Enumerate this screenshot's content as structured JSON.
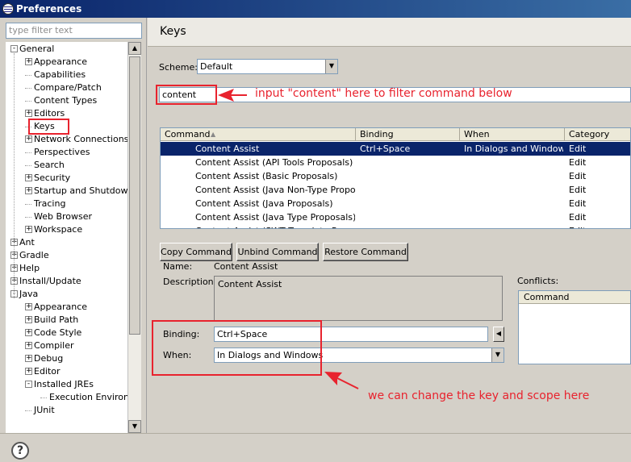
{
  "window": {
    "title": "Preferences"
  },
  "filter": {
    "placeholder": "type filter text"
  },
  "tree": [
    {
      "label": "General",
      "level": 0,
      "expander": "-"
    },
    {
      "label": "Appearance",
      "level": 1,
      "expander": "+"
    },
    {
      "label": "Capabilities",
      "level": 1,
      "expander": ""
    },
    {
      "label": "Compare/Patch",
      "level": 1,
      "expander": ""
    },
    {
      "label": "Content Types",
      "level": 1,
      "expander": ""
    },
    {
      "label": "Editors",
      "level": 1,
      "expander": "+"
    },
    {
      "label": "Keys",
      "level": 1,
      "expander": "",
      "selected": true
    },
    {
      "label": "Network Connections",
      "level": 1,
      "expander": "+"
    },
    {
      "label": "Perspectives",
      "level": 1,
      "expander": ""
    },
    {
      "label": "Search",
      "level": 1,
      "expander": ""
    },
    {
      "label": "Security",
      "level": 1,
      "expander": "+"
    },
    {
      "label": "Startup and Shutdown",
      "level": 1,
      "expander": "+"
    },
    {
      "label": "Tracing",
      "level": 1,
      "expander": ""
    },
    {
      "label": "Web Browser",
      "level": 1,
      "expander": ""
    },
    {
      "label": "Workspace",
      "level": 1,
      "expander": "+"
    },
    {
      "label": "Ant",
      "level": 0,
      "expander": "+"
    },
    {
      "label": "Gradle",
      "level": 0,
      "expander": "+"
    },
    {
      "label": "Help",
      "level": 0,
      "expander": "+"
    },
    {
      "label": "Install/Update",
      "level": 0,
      "expander": "+"
    },
    {
      "label": "Java",
      "level": 0,
      "expander": "-"
    },
    {
      "label": "Appearance",
      "level": 1,
      "expander": "+"
    },
    {
      "label": "Build Path",
      "level": 1,
      "expander": "+"
    },
    {
      "label": "Code Style",
      "level": 1,
      "expander": "+"
    },
    {
      "label": "Compiler",
      "level": 1,
      "expander": "+"
    },
    {
      "label": "Debug",
      "level": 1,
      "expander": "+"
    },
    {
      "label": "Editor",
      "level": 1,
      "expander": "+"
    },
    {
      "label": "Installed JREs",
      "level": 1,
      "expander": "-"
    },
    {
      "label": "Execution Environ",
      "level": 2,
      "expander": ""
    },
    {
      "label": "JUnit",
      "level": 1,
      "expander": ""
    }
  ],
  "page": {
    "title": "Keys"
  },
  "scheme": {
    "label": "Scheme:",
    "value": "Default"
  },
  "filter_input": {
    "value": "content"
  },
  "table": {
    "columns": [
      "Command",
      "Binding",
      "When",
      "Category"
    ],
    "rows": [
      {
        "command": "Content Assist",
        "binding": "Ctrl+Space",
        "when": "In Dialogs and Windows",
        "category": "Edit",
        "selected": true
      },
      {
        "command": "Content Assist (API Tools Proposals)",
        "binding": "",
        "when": "",
        "category": "Edit"
      },
      {
        "command": "Content Assist (Basic Proposals)",
        "binding": "",
        "when": "",
        "category": "Edit"
      },
      {
        "command": "Content Assist (Java Non-Type Proposals",
        "binding": "",
        "when": "",
        "category": "Edit"
      },
      {
        "command": "Content Assist (Java Proposals)",
        "binding": "",
        "when": "",
        "category": "Edit"
      },
      {
        "command": "Content Assist (Java Type Proposals)",
        "binding": "",
        "when": "",
        "category": "Edit"
      },
      {
        "command": "Content Assist (SWT Template Proposals)",
        "binding": "",
        "when": "",
        "category": "Edit"
      }
    ]
  },
  "buttons": {
    "copy": "Copy Command",
    "unbind": "Unbind Command",
    "restore": "Restore Command"
  },
  "details": {
    "name_label": "Name:",
    "name_value": "Content Assist",
    "description_label": "Description:",
    "description_value": "Content Assist",
    "binding_label": "Binding:",
    "binding_value": "Ctrl+Space",
    "when_label": "When:",
    "when_value": "In Dialogs and Windows",
    "conflicts_label": "Conflicts:",
    "conflicts_column": "Command"
  },
  "annotations": {
    "filter_note": "input \"content\" here to filter command below",
    "binding_note": "we can change the key and scope here",
    "color": "#e8232e"
  },
  "help": {
    "label": "?"
  }
}
